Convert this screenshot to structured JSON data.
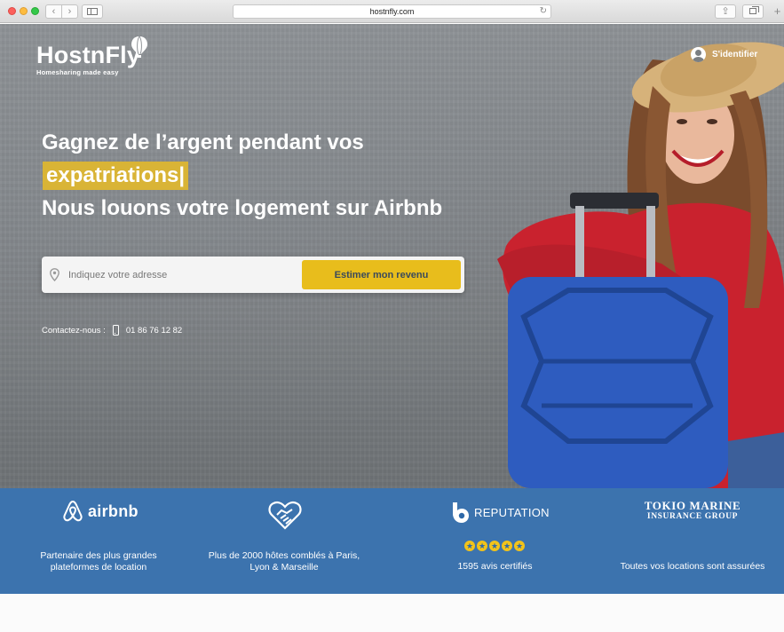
{
  "browser": {
    "url": "hostnfly.com",
    "back_glyph": "‹",
    "forward_glyph": "›",
    "reload_glyph": "↻",
    "share_glyph": "⇪",
    "new_tab_glyph": "+"
  },
  "header": {
    "logo_name": "HostnFly",
    "logo_tagline": "Homesharing made easy",
    "login_label": "S'identifier"
  },
  "hero": {
    "headline_line1": "Gagnez de l’argent pendant vos",
    "headline_highlight": "expatriations|",
    "headline_line3": "Nous louons votre logement sur Airbnb",
    "search_placeholder": "Indiquez votre adresse",
    "search_value": "",
    "estimate_button": "Estimer mon revenu",
    "contact_label": "Contactez-nous :",
    "contact_phone": "01 86 76 12 82"
  },
  "partners": [
    {
      "logo": "airbnb",
      "caption_line1": "Partenaire des plus grandes",
      "caption_line2": "plateformes de location"
    },
    {
      "logo": "handshake-heart",
      "caption_line1": "Plus de 2000 hôtes comblés à Paris,",
      "caption_line2": "Lyon & Marseille"
    },
    {
      "logo": "REPUTATION",
      "rating_stars": 5,
      "caption_line1": "1595 avis certifiés"
    },
    {
      "logo_line1": "TOKIO MARINE",
      "logo_line2": "INSURANCE GROUP",
      "caption_line1": "Toutes vos locations sont assurées"
    }
  ],
  "colors": {
    "accent_yellow": "#e8bd1c",
    "highlight_yellow": "#d9b436",
    "band_blue": "#2d68a8",
    "suitcase_blue": "#2e5cbf",
    "sweater_red": "#c9222e"
  }
}
